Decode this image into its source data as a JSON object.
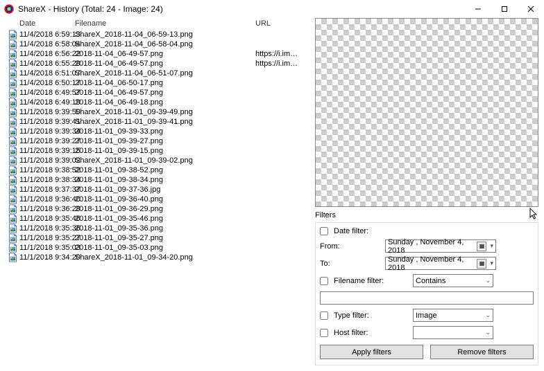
{
  "window": {
    "title": "ShareX - History (Total: 24 - Image: 24)"
  },
  "columns": {
    "date": "Date",
    "filename": "Filename",
    "url": "URL"
  },
  "rows": [
    {
      "date": "11/4/2018 6:59:13",
      "filename": "ShareX_2018-11-04_06-59-13.png",
      "url": ""
    },
    {
      "date": "11/4/2018 6:58:04",
      "filename": "ShareX_2018-11-04_06-58-04.png",
      "url": ""
    },
    {
      "date": "11/4/2018 6:56:22",
      "filename": "2018-11-04_06-49-57.png",
      "url": "https://i.im…"
    },
    {
      "date": "11/4/2018 6:55:29",
      "filename": "2018-11-04_06-49-57.png",
      "url": "https://i.im…"
    },
    {
      "date": "11/4/2018 6:51:07",
      "filename": "ShareX_2018-11-04_06-51-07.png",
      "url": ""
    },
    {
      "date": "11/4/2018 6:50:17",
      "filename": "2018-11-04_06-50-17.png",
      "url": ""
    },
    {
      "date": "11/4/2018 6:49:57",
      "filename": "2018-11-04_06-49-57.png",
      "url": ""
    },
    {
      "date": "11/4/2018 6:49:19",
      "filename": "2018-11-04_06-49-18.png",
      "url": ""
    },
    {
      "date": "11/1/2018 9:39:50",
      "filename": "ShareX_2018-11-01_09-39-49.png",
      "url": ""
    },
    {
      "date": "11/1/2018 9:39:41",
      "filename": "ShareX_2018-11-01_09-39-41.png",
      "url": ""
    },
    {
      "date": "11/1/2018 9:39:34",
      "filename": "2018-11-01_09-39-33.png",
      "url": ""
    },
    {
      "date": "11/1/2018 9:39:27",
      "filename": "2018-11-01_09-39-27.png",
      "url": ""
    },
    {
      "date": "11/1/2018 9:39:15",
      "filename": "2018-11-01_09-39-15.png",
      "url": ""
    },
    {
      "date": "11/1/2018 9:39:02",
      "filename": "ShareX_2018-11-01_09-39-02.png",
      "url": ""
    },
    {
      "date": "11/1/2018 9:38:52",
      "filename": "2018-11-01_09-38-52.png",
      "url": ""
    },
    {
      "date": "11/1/2018 9:38:34",
      "filename": "2018-11-01_09-38-34.png",
      "url": ""
    },
    {
      "date": "11/1/2018 9:37:37",
      "filename": "2018-11-01_09-37-36.jpg",
      "url": ""
    },
    {
      "date": "11/1/2018 9:36:40",
      "filename": "2018-11-01_09-36-40.png",
      "url": ""
    },
    {
      "date": "11/1/2018 9:36:29",
      "filename": "2018-11-01_09-36-29.png",
      "url": ""
    },
    {
      "date": "11/1/2018 9:35:46",
      "filename": "2018-11-01_09-35-46.png",
      "url": ""
    },
    {
      "date": "11/1/2018 9:35:36",
      "filename": "2018-11-01_09-35-36.png",
      "url": ""
    },
    {
      "date": "11/1/2018 9:35:27",
      "filename": "2018-11-01_09-35-27.png",
      "url": ""
    },
    {
      "date": "11/1/2018 9:35:03",
      "filename": "2018-11-01_09-35-03.png",
      "url": ""
    },
    {
      "date": "11/1/2018 9:34:20",
      "filename": "ShareX_2018-11-01_09-34-20.png",
      "url": ""
    }
  ],
  "filters": {
    "section_label": "Filters",
    "date_filter_label": "Date filter:",
    "from_label": "From:",
    "to_label": "To:",
    "from_value": "Sunday   , November   4, 2018",
    "to_value": "Sunday   , November   4, 2018",
    "filename_filter_label": "Filename filter:",
    "filename_mode": "Contains",
    "filename_value": "",
    "type_filter_label": "Type filter:",
    "type_value": "Image",
    "host_filter_label": "Host filter:",
    "host_value": "",
    "apply_label": "Apply filters",
    "remove_label": "Remove filters"
  }
}
